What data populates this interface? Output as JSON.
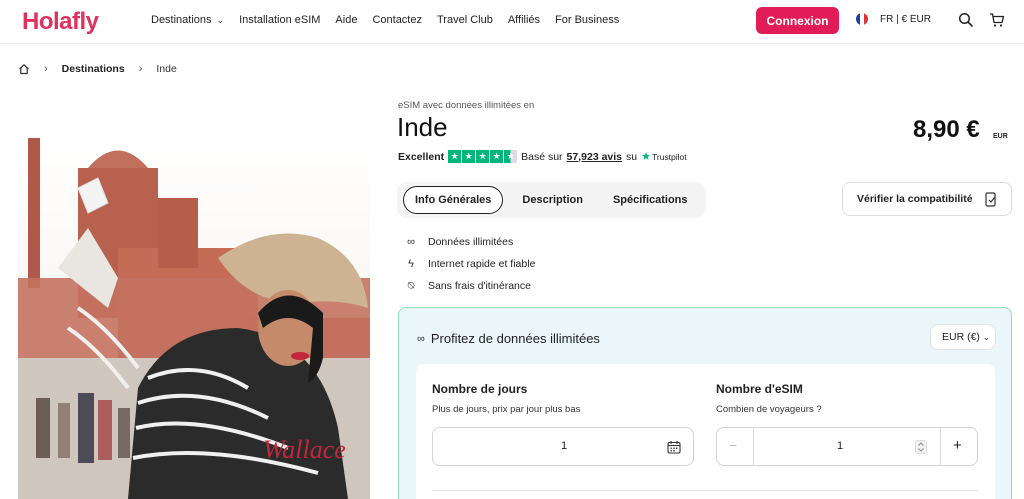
{
  "header": {
    "logo": "Holafly",
    "nav": [
      {
        "label": "Destinations",
        "has_dropdown": true
      },
      {
        "label": "Installation eSIM",
        "has_dropdown": false
      },
      {
        "label": "Aide",
        "has_dropdown": false
      },
      {
        "label": "Contactez",
        "has_dropdown": false
      },
      {
        "label": "Travel Club",
        "has_dropdown": false
      },
      {
        "label": "Affiliés",
        "has_dropdown": false
      },
      {
        "label": "For Business",
        "has_dropdown": false
      }
    ],
    "login_label": "Connexion",
    "language": "FR | € EUR",
    "brand_color": "#e21c56"
  },
  "breadcrumb": {
    "home_icon": "home-icon",
    "destinations": "Destinations",
    "current": "Inde"
  },
  "product": {
    "eyebrow": "eSIM avec données illimitées en",
    "title": "Inde",
    "price": "8,90 €",
    "currency": "EUR",
    "rating": {
      "label": "Excellent",
      "stars": 4.5,
      "based_on": "Basé sur",
      "reviews": "57,923 avis",
      "on": "su",
      "provider": "Trustpilot"
    }
  },
  "tabs": [
    {
      "label": "Info Générales",
      "active": true
    },
    {
      "label": "Description",
      "active": false
    },
    {
      "label": "Spécifications",
      "active": false
    }
  ],
  "compatibility_button": "Vérifier la compatibilité",
  "features": [
    {
      "icon": "infinity-icon",
      "label": "Données illimitées"
    },
    {
      "icon": "bolt-icon",
      "label": "Internet rapide et fiable"
    },
    {
      "icon": "no-roaming-icon",
      "label": "Sans frais d'itinérance"
    }
  ],
  "plan": {
    "title": "Profitez de données illimitées",
    "currency_select": "EUR (€)",
    "days": {
      "label": "Nombre de jours",
      "sub": "Plus de jours, prix par jour plus bas",
      "value": "1"
    },
    "esims": {
      "label": "Nombre d'eSIM",
      "sub": "Combien de voyageurs ?",
      "value": "1",
      "minus": "−",
      "plus": "+"
    }
  }
}
